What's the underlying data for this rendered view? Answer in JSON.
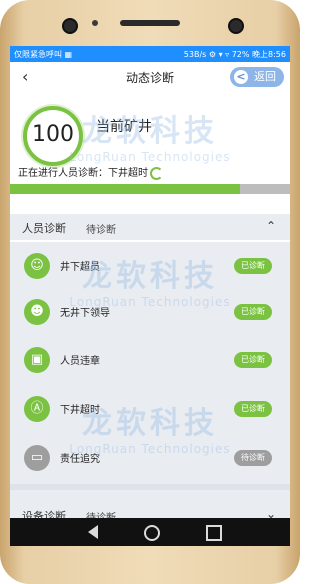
{
  "status_bar": {
    "left": "仅限紧急呼叫 ▦",
    "right": "53B/s ⚙ ▾ ▿ 72% 晚上8:56"
  },
  "header": {
    "back_icon": "chevron-left-icon",
    "title": "动态诊断",
    "return_label": "返回"
  },
  "summary": {
    "score": "100",
    "mine_name": "当前矿井",
    "status_text": "正在进行人员诊断：下井超时",
    "progress": 0.82,
    "progress_color": "#7bc242"
  },
  "personnel_section": {
    "title": "人员诊断",
    "status": "待诊断",
    "chevron": "chevron-up-icon",
    "items": [
      {
        "label": "井下超员",
        "tag": "已诊断",
        "done": true,
        "icon": "people-icon"
      },
      {
        "label": "无井下领导",
        "tag": "已诊断",
        "done": true,
        "icon": "person-icon"
      },
      {
        "label": "人员违章",
        "tag": "已诊断",
        "done": true,
        "icon": "id-card-icon"
      },
      {
        "label": "下井超时",
        "tag": "已诊断",
        "done": true,
        "icon": "clock-a-icon"
      },
      {
        "label": "责任追究",
        "tag": "待诊断",
        "done": false,
        "icon": "car-icon"
      }
    ]
  },
  "equipment_section": {
    "title": "设备诊断",
    "status": "待诊断",
    "chevron": "chevron-down-icon"
  },
  "watermark": {
    "cn": "龙软科技",
    "en": "LongRuan Technologies"
  },
  "colors": {
    "accent_green": "#7bc242",
    "status_blue": "#1f8fff",
    "pending_grey": "#9e9e9e"
  }
}
